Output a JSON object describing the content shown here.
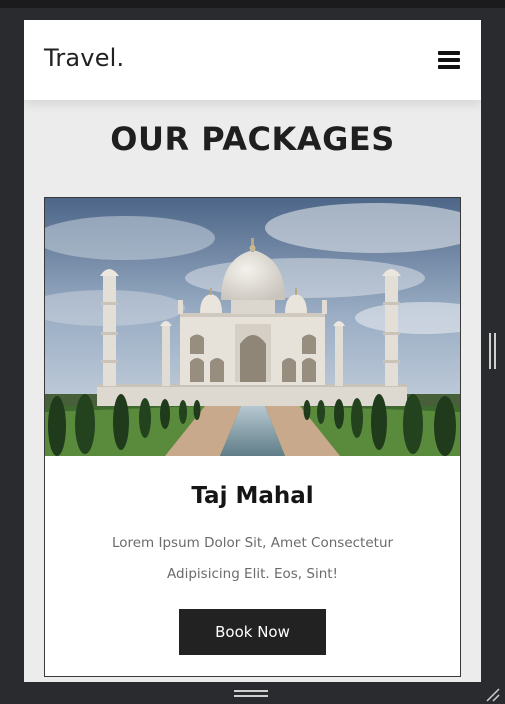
{
  "navbar": {
    "brand": "Travel.",
    "menu_icon": "hamburger-menu-icon"
  },
  "packages": {
    "title": "OUR PACKAGES",
    "cards": [
      {
        "title": "Taj Mahal",
        "description": "Lorem Ipsum Dolor Sit, Amet Consectetur Adipisicing Elit. Eos, Sint!",
        "button_label": "Book Now",
        "image": "taj-mahal-photo"
      }
    ]
  },
  "device_frame": {
    "right_handle_icon": "vertical-resize-handle-icon",
    "bottom_handle_icon": "horizontal-resize-handle-icon",
    "corner_handle_icon": "corner-resize-icon"
  },
  "colors": {
    "page_background": "#ececec",
    "button_background": "#222222",
    "frame": "#2a2b2e"
  }
}
